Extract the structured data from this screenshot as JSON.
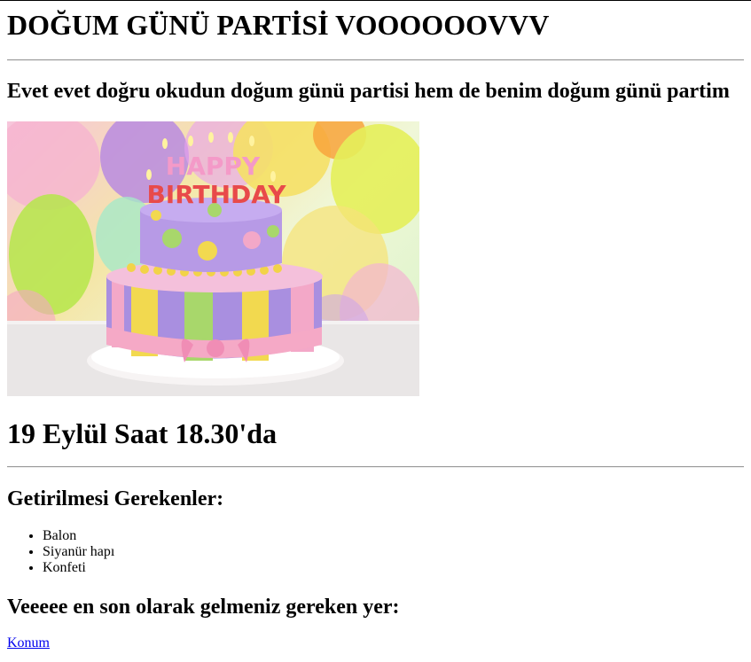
{
  "page": {
    "title": "DOĞUM GÜNÜ PARTİSİ VOOOOOOVVV",
    "subtitle": "Evet evet doğru okudun doğum günü partisi hem de benim doğum günü partim",
    "date": "19 Eylül Saat 18.30'da",
    "needs_heading": "Getirilmesi Gerekenler:",
    "needs_items": [
      "Balon",
      "Siyanür hapı",
      "Konfeti"
    ],
    "place_heading": "Veeeee en son olarak gelmeniz gereken yer:",
    "location_link": "Konum"
  },
  "image": {
    "topper_text_top": "HAPPY",
    "topper_text_bottom": "BIRTHDAY"
  },
  "colors": {
    "link": "#0000ee",
    "rule": "#9a9a9a"
  }
}
